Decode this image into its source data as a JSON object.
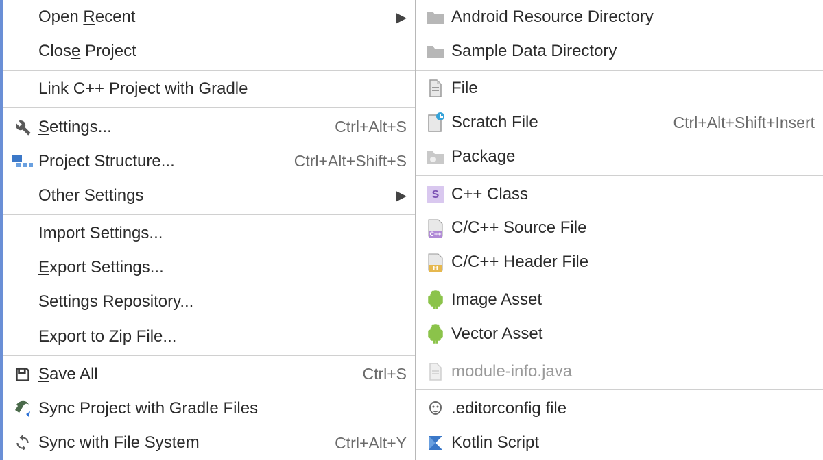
{
  "left_menu": [
    {
      "type": "item",
      "icon": "",
      "label_pre": "Open ",
      "ul": "R",
      "label_post": "ecent",
      "shortcut": "",
      "sub": true
    },
    {
      "type": "item",
      "icon": "",
      "label_pre": "Clos",
      "ul": "e",
      "label_post": " Project",
      "shortcut": "",
      "sub": false
    },
    {
      "type": "sep"
    },
    {
      "type": "item",
      "icon": "",
      "label_pre": "Link C++ Project with Gradle",
      "ul": "",
      "label_post": "",
      "shortcut": "",
      "sub": false
    },
    {
      "type": "sep"
    },
    {
      "type": "item",
      "icon": "wrench",
      "label_pre": "",
      "ul": "S",
      "label_post": "ettings...",
      "shortcut": "Ctrl+Alt+S",
      "sub": false
    },
    {
      "type": "item",
      "icon": "proj-struct",
      "label_pre": "Project Structure...",
      "ul": "",
      "label_post": "",
      "shortcut": "Ctrl+Alt+Shift+S",
      "sub": false
    },
    {
      "type": "item",
      "icon": "",
      "label_pre": "Other Settings",
      "ul": "",
      "label_post": "",
      "shortcut": "",
      "sub": true
    },
    {
      "type": "sep"
    },
    {
      "type": "item",
      "icon": "",
      "label_pre": "Import Settings...",
      "ul": "",
      "label_post": "",
      "shortcut": "",
      "sub": false
    },
    {
      "type": "item",
      "icon": "",
      "label_pre": "",
      "ul": "E",
      "label_post": "xport Settings...",
      "shortcut": "",
      "sub": false
    },
    {
      "type": "item",
      "icon": "",
      "label_pre": "Settings Repository...",
      "ul": "",
      "label_post": "",
      "shortcut": "",
      "sub": false
    },
    {
      "type": "item",
      "icon": "",
      "label_pre": "Export to Zip File...",
      "ul": "",
      "label_post": "",
      "shortcut": "",
      "sub": false
    },
    {
      "type": "sep"
    },
    {
      "type": "item",
      "icon": "save",
      "label_pre": "",
      "ul": "S",
      "label_post": "ave All",
      "shortcut": "Ctrl+S",
      "sub": false
    },
    {
      "type": "item",
      "icon": "sync-gradle",
      "label_pre": "Sync Project with Gradle Files",
      "ul": "",
      "label_post": "",
      "shortcut": "",
      "sub": false
    },
    {
      "type": "item",
      "icon": "sync",
      "label_pre": "S",
      "ul": "y",
      "label_post": "nc with File System",
      "shortcut": "Ctrl+Alt+Y",
      "sub": false
    }
  ],
  "right_menu": [
    {
      "type": "item",
      "icon": "folder-grey",
      "label": "Android Resource Directory",
      "shortcut": "",
      "disabled": false
    },
    {
      "type": "item",
      "icon": "folder-grey",
      "label": "Sample Data Directory",
      "shortcut": "",
      "disabled": false
    },
    {
      "type": "sep"
    },
    {
      "type": "item",
      "icon": "file",
      "label": "File",
      "shortcut": "",
      "disabled": false
    },
    {
      "type": "item",
      "icon": "scratch",
      "label": "Scratch File",
      "shortcut": "Ctrl+Alt+Shift+Insert",
      "disabled": false
    },
    {
      "type": "item",
      "icon": "package",
      "label": "Package",
      "shortcut": "",
      "disabled": false
    },
    {
      "type": "sep"
    },
    {
      "type": "item",
      "icon": "cpp-class",
      "label": "C++ Class",
      "shortcut": "",
      "disabled": false
    },
    {
      "type": "item",
      "icon": "cpp-src",
      "label": "C/C++ Source File",
      "shortcut": "",
      "disabled": false
    },
    {
      "type": "item",
      "icon": "cpp-hdr",
      "label": "C/C++ Header File",
      "shortcut": "",
      "disabled": false
    },
    {
      "type": "sep"
    },
    {
      "type": "item",
      "icon": "android",
      "label": "Image Asset",
      "shortcut": "",
      "disabled": false
    },
    {
      "type": "item",
      "icon": "android",
      "label": "Vector Asset",
      "shortcut": "",
      "disabled": false
    },
    {
      "type": "sep"
    },
    {
      "type": "item",
      "icon": "file-grey",
      "label": "module-info.java",
      "shortcut": "",
      "disabled": true
    },
    {
      "type": "sep"
    },
    {
      "type": "item",
      "icon": "editorconfig",
      "label": ".editorconfig file",
      "shortcut": "",
      "disabled": false
    },
    {
      "type": "item",
      "icon": "kotlin",
      "label": "Kotlin Script",
      "shortcut": "",
      "disabled": false
    }
  ]
}
